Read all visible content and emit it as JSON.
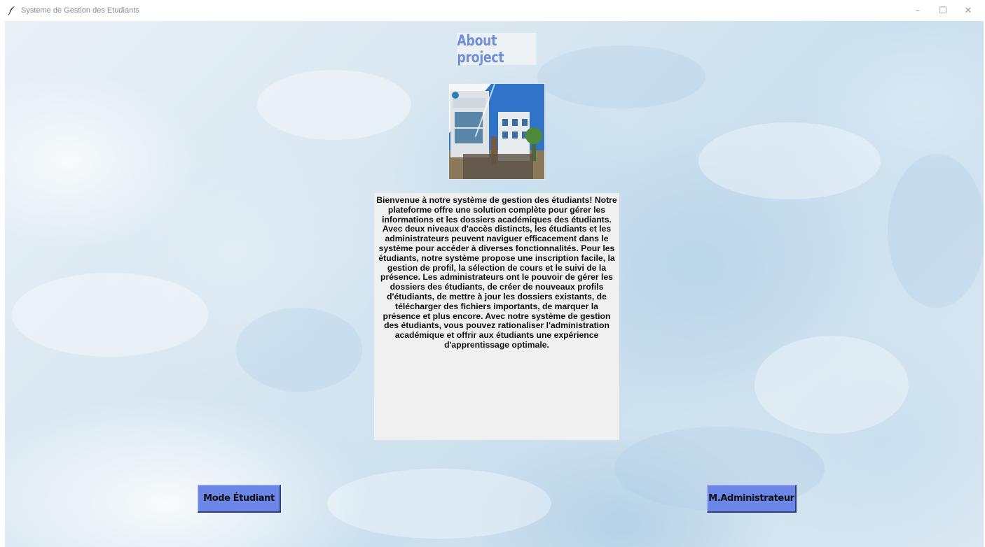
{
  "window": {
    "title": "Systeme de Gestion des Etudiants",
    "app_icon": "feather-icon",
    "controls": {
      "minimize": "–",
      "maximize": "☐",
      "close": "✕"
    }
  },
  "main": {
    "heading": "About project",
    "photo": {
      "icon": "campus-building-photo"
    },
    "description": "Bienvenue à notre système de gestion des étudiants! Notre plateforme offre une solution complète pour gérer les informations et les dossiers académiques des étudiants. Avec deux niveaux d'accès distincts, les étudiants et les administrateurs peuvent naviguer efficacement dans le système pour accéder à diverses fonctionnalités. Pour les étudiants, notre système propose une inscription facile, la gestion de profil, la sélection de cours et le suivi de la présence. Les administrateurs ont le pouvoir de gérer les dossiers des étudiants, de créer de nouveaux profils d'étudiants, de mettre à jour les dossiers existants, de télécharger des fichiers importants, de marquer la présence et plus encore. Avec notre système de gestion des étudiants, vous pouvez rationaliser l'administration académique et offrir aux étudiants une expérience d'apprentissage optimale."
  },
  "buttons": {
    "student_mode": "Mode Étudiant",
    "admin_mode": "M.Administrateur"
  },
  "colors": {
    "heading": "#6f8fd8",
    "button_bg": "#6b86e6",
    "panel_bg": "#f0f0f0"
  }
}
